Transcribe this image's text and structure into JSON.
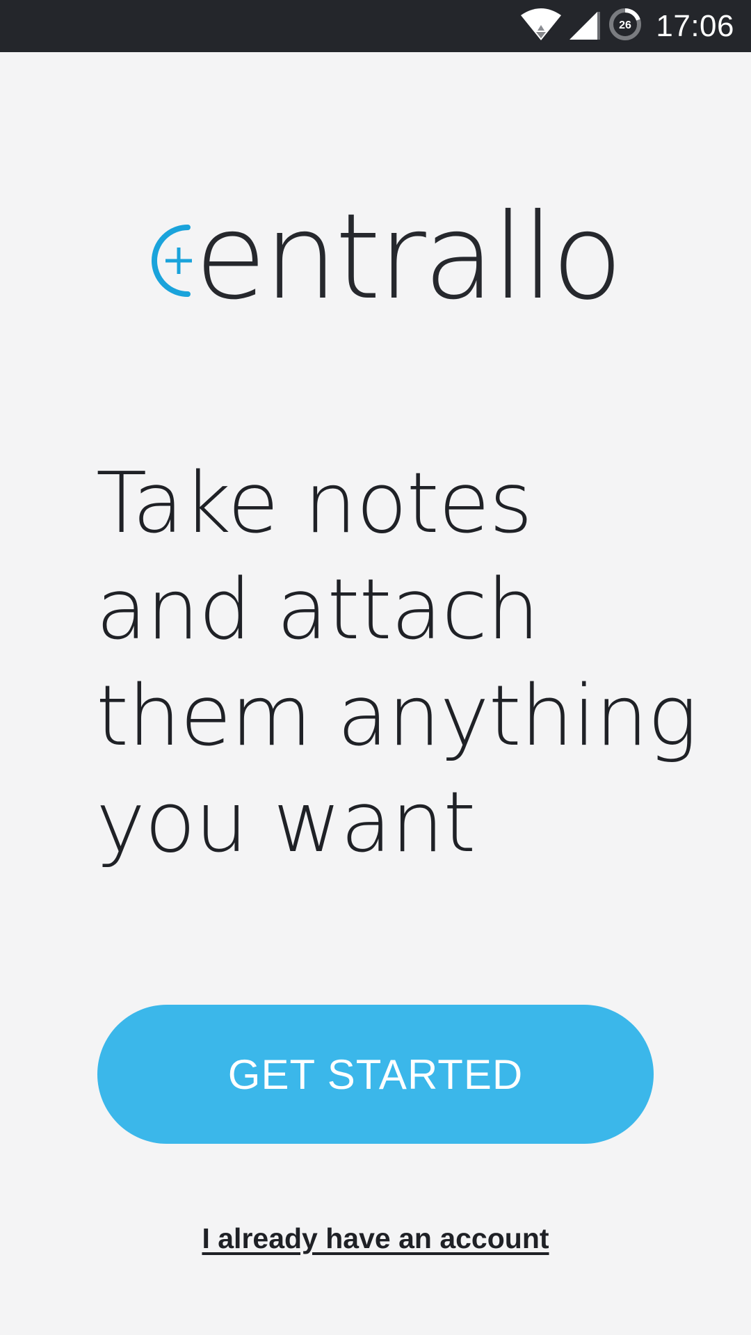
{
  "status_bar": {
    "time": "17:06",
    "battery_level": "26",
    "icons": [
      "wifi-icon",
      "cell-signal-icon",
      "battery-icon"
    ]
  },
  "logo": {
    "text": "centrallo",
    "accent_color": "#1aa3db",
    "text_color": "#26282d"
  },
  "tagline": {
    "lines": [
      "Take notes",
      "and attach",
      "them anything",
      "you want"
    ]
  },
  "actions": {
    "get_started_label": "GET STARTED",
    "get_started_color": "#3bb7ea",
    "existing_account_label": "I already have an account"
  }
}
